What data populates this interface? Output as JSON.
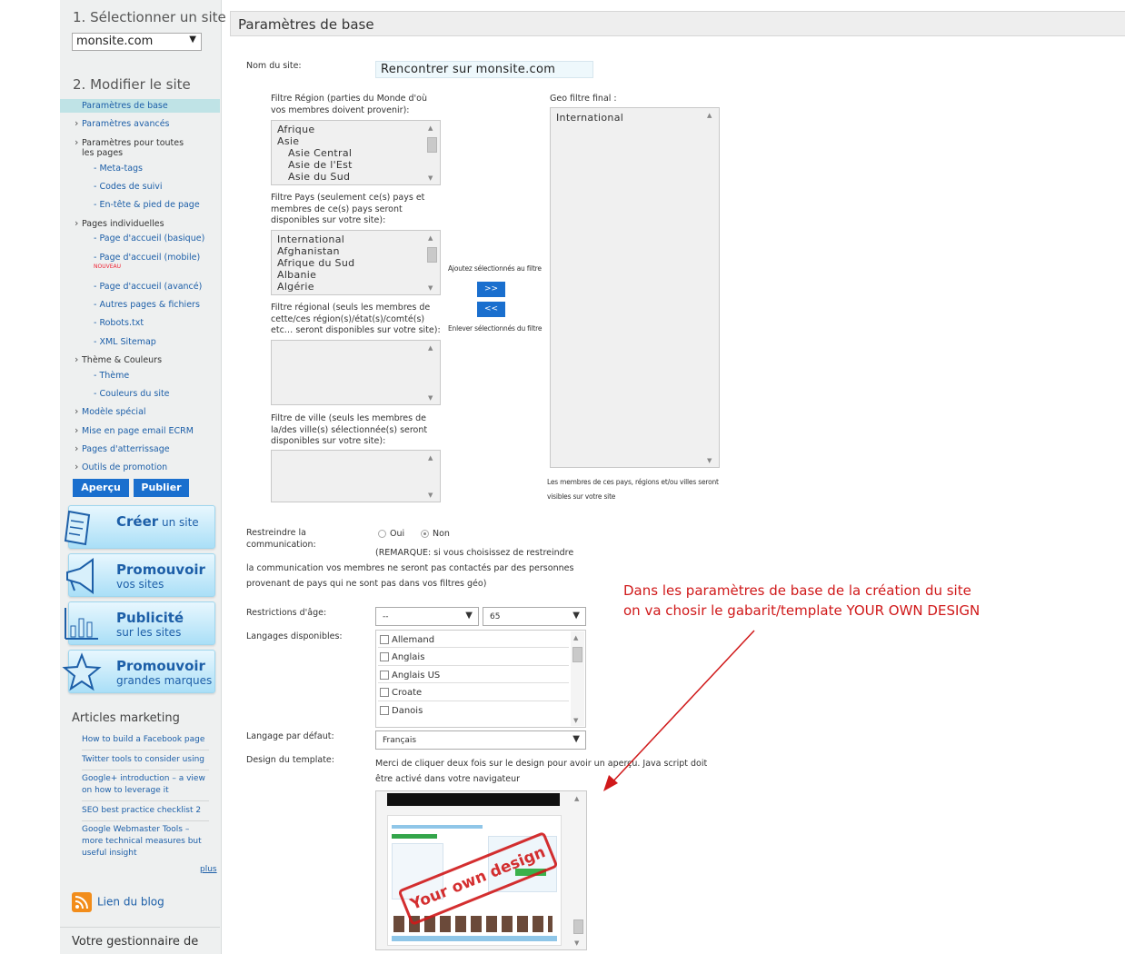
{
  "sidebar": {
    "step1": "1. Sélectionner un site",
    "site_value": "monsite.com",
    "step2": "2. Modifier le site",
    "nav": [
      "Paramètres de base",
      "Paramètres avancés",
      "Paramètres pour toutes les pages",
      "- Meta-tags",
      "- Codes de suivi",
      "- En-tête & pied de page",
      "Pages individuelles",
      "- Page d'accueil (basique)",
      "- Page d'accueil (mobile)",
      "- Page d'accueil (avancé)",
      "- Autres pages & fichiers",
      "- Robots.txt",
      "- XML Sitemap",
      "Thème & Couleurs",
      "- Thème",
      "- Couleurs du site",
      "Modèle spécial",
      "Mise en page email ECRM",
      "Pages d'atterrissage",
      "Outils de promotion"
    ],
    "nouveau": "NOUVEAU",
    "apercu": "Aperçu",
    "publier": "Publier",
    "promos": [
      {
        "bold": "Créer",
        "rest": " un site",
        "line2": ""
      },
      {
        "bold": "Promouvoir",
        "rest": "",
        "line2": "vos sites"
      },
      {
        "bold": "Publicité",
        "rest": "",
        "line2": "sur les sites"
      },
      {
        "bold": "Promouvoir",
        "rest": "",
        "line2": "grandes marques"
      }
    ],
    "articles_title": "Articles marketing",
    "articles": [
      "How to build a Facebook page",
      "Twitter tools to consider using",
      "Google+ introduction – a view on how to leverage it",
      "SEO best practice checklist 2",
      "Google Webmaster Tools – more technical measures but useful insight"
    ],
    "plus": "plus",
    "blog": "Lien du blog",
    "manager": "Votre gestionnaire de"
  },
  "main": {
    "title": "Paramètres de base",
    "site_name_label": "Nom du site:",
    "site_name_value": "Rencontrer sur monsite.com",
    "region_label": "Filtre Région (parties du Monde d'où vos membres doivent provenir):",
    "regions": [
      "Afrique",
      "Asie",
      "Asie Central",
      "Asie de l'Est",
      "Asie du Sud"
    ],
    "country_label": "Filtre Pays (seulement ce(s) pays et membres de ce(s) pays seront disponibles sur votre site):",
    "countries": [
      "International",
      "Afghanistan",
      "Afrique du Sud",
      "Albanie",
      "Algérie"
    ],
    "regional_label": "Filtre régional (seuls les membres de cette/ces région(s)/état(s)/comté(s) etc… seront disponibles sur votre site):",
    "city_label": "Filtre de ville (seuls les membres de la/des ville(s) sélectionnée(s) seront disponibles sur votre site):",
    "geo_label": "Geo filtre final :",
    "geo_items": [
      "International"
    ],
    "add_text": "Ajoutez sélectionnés au filtre",
    "add_btn": ">>",
    "remove_btn": "<<",
    "remove_text": "Enlever sélectionnés du filtre",
    "geo_note": "Les membres de ces pays, régions et/ou villes seront visibles sur votre site",
    "restrict_label": "Restreindre la communication:",
    "oui": "Oui",
    "non": "Non",
    "restrict_note": "(REMARQUE: si vous choisissez de restreindre la communication vos membres ne seront pas contactés par des personnes provenant de pays qui ne sont pas dans vos filtres géo)",
    "age_label": "Restrictions d'âge:",
    "age_min": "--",
    "age_max": "65",
    "lang_label": "Langages disponibles:",
    "languages": [
      "Allemand",
      "Anglais",
      "Anglais US",
      "Croate",
      "Danois"
    ],
    "default_lang_label": "Langage par défaut:",
    "default_lang": "Français",
    "design_label": "Design du template:",
    "design_note": "Merci de cliquer deux fois sur le design pour avoir un aperçu. Java script doit être activé dans votre navigateur",
    "stamp_text": "Your own design"
  },
  "annotation": {
    "line1": "Dans les paramètres de base de la création du site",
    "line2": "on va chosir le gabarit/template YOUR OWN DESIGN"
  },
  "colors": {
    "accent": "#1a6fce",
    "annotation": "#d0191a",
    "active_nav": "#bfe3e6"
  }
}
